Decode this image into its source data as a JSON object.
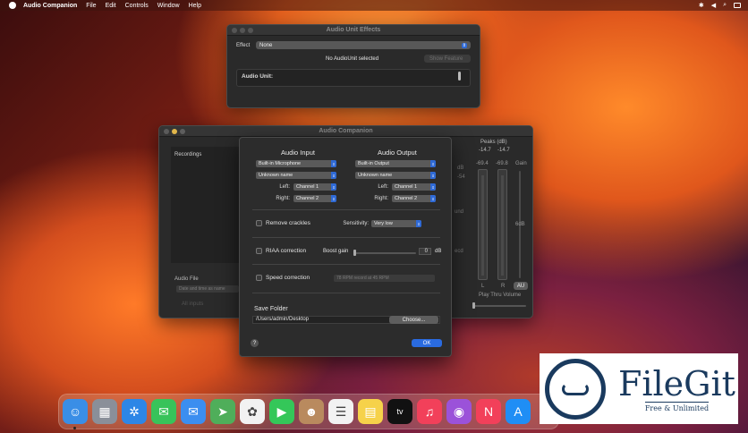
{
  "menubar": {
    "app_name": "Audio Companion",
    "items": [
      "File",
      "Edit",
      "Controls",
      "Window",
      "Help"
    ],
    "icons": [
      "apple-icon",
      "bluetooth-icon",
      "volume-icon",
      "search-icon",
      "control-center-icon"
    ]
  },
  "au_window": {
    "title": "Audio Unit Effects",
    "effect_label": "Effect",
    "effect_value": "None",
    "status": "No AudioUnit selected",
    "show_feature_button": "Show Feature",
    "audio_unit_label": "Audio Unit:"
  },
  "main_window": {
    "title": "Audio Companion",
    "recordings_label": "Recordings",
    "audio_file_label": "Audio File",
    "file_name_placeholder": "Date and time as name",
    "all_inputs": "All inputs",
    "peaks_title": "Peaks (dB)",
    "peak_values": [
      "-14.7",
      "-14.7"
    ],
    "meter_values": [
      "-69.4",
      "-69.8"
    ],
    "gain_label": "Gain",
    "side_values": [
      "dB",
      "-54",
      "und",
      "ecd"
    ],
    "gain_value": "6dB",
    "channel_labels": [
      "L",
      "R"
    ],
    "au_button": "AU",
    "play_thru_label": "Play Thru Volume"
  },
  "prefs": {
    "audio_input_title": "Audio Input",
    "audio_output_title": "Audio Output",
    "input_device": "Built-in Microphone",
    "input_name": "Unknown name",
    "input_left_label": "Left:",
    "input_left": "Channel 1",
    "input_right_label": "Right:",
    "input_right": "Channel 2",
    "output_device": "Built-in Output",
    "output_name": "Unknown name",
    "output_left_label": "Left:",
    "output_left": "Channel 1",
    "output_right_label": "Right:",
    "output_right": "Channel 2",
    "remove_crackles": "Remove crackles",
    "sensitivity_label": "Sensitivity:",
    "sensitivity_value": "Very low",
    "riaa_correction": "RIAA correction",
    "boost_gain_label": "Boost gain",
    "boost_gain_value": "0",
    "boost_gain_unit": "dB",
    "speed_correction": "Speed correction",
    "speed_value": "78 RPM record at 45 RPM",
    "save_folder_title": "Save Folder",
    "save_path": "/Users/admin/Desktop",
    "choose_button": "Choose...",
    "help_button": "?",
    "ok_button": "OK"
  },
  "dock": {
    "apps": [
      {
        "name": "finder-icon",
        "color": "#3a8ee6",
        "glyph": "☺"
      },
      {
        "name": "launchpad-icon",
        "color": "#8a8f99",
        "glyph": "▦"
      },
      {
        "name": "safari-icon",
        "color": "#2d86e6",
        "glyph": "✲"
      },
      {
        "name": "messages-icon",
        "color": "#38c35a",
        "glyph": "✉"
      },
      {
        "name": "mail-icon",
        "color": "#3b8ef0",
        "glyph": "✉"
      },
      {
        "name": "maps-icon",
        "color": "#4fae5a",
        "glyph": "➤"
      },
      {
        "name": "photos-icon",
        "color": "#f2f2f2",
        "glyph": "✿"
      },
      {
        "name": "facetime-icon",
        "color": "#34c759",
        "glyph": "▶"
      },
      {
        "name": "contacts-icon",
        "color": "#b98a5e",
        "glyph": "☻"
      },
      {
        "name": "reminders-icon",
        "color": "#f2f2f2",
        "glyph": "☰"
      },
      {
        "name": "notes-icon",
        "color": "#f6d24a",
        "glyph": "▤"
      },
      {
        "name": "tv-icon",
        "color": "#111111",
        "glyph": "tv"
      },
      {
        "name": "music-icon",
        "color": "#f2405a",
        "glyph": "♫"
      },
      {
        "name": "podcasts-icon",
        "color": "#9b52d9",
        "glyph": "◉"
      },
      {
        "name": "news-icon",
        "color": "#f2405a",
        "glyph": "N"
      },
      {
        "name": "app-store-icon",
        "color": "#1f8ef5",
        "glyph": "A"
      }
    ]
  },
  "watermark": {
    "title": "FileGit",
    "subtitle": "Free & Unlimited"
  }
}
